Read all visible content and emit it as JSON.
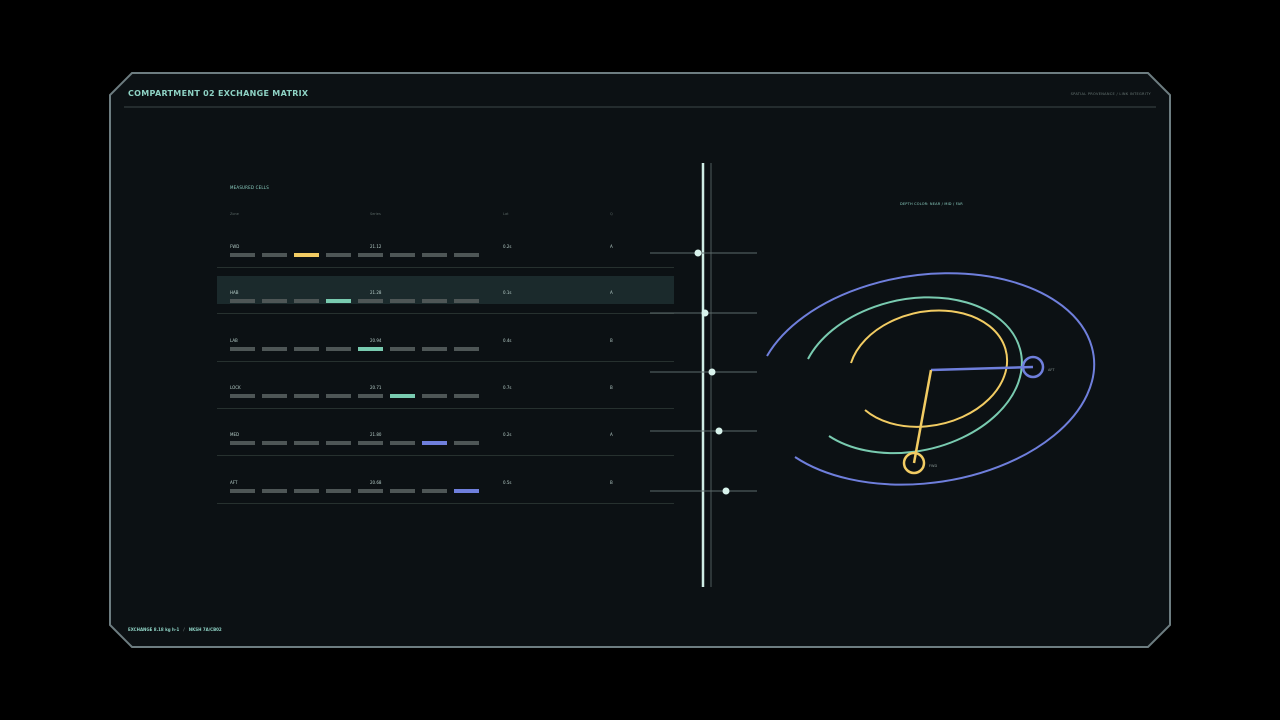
{
  "header": {
    "title": "COMPARTMENT 02 EXCHANGE MATRIX",
    "subtitle": "SPATIAL PROVENANCE / LINK INTEGRITY"
  },
  "table": {
    "section_label": "MEASURED CELLS",
    "columns": [
      "Zone",
      "Series",
      "Lat",
      "Q"
    ],
    "rows": [
      {
        "name": "FWD",
        "value": "21.12",
        "latency": "0.2s",
        "grade": "A",
        "active_cell": 2,
        "active_color": "#f2cc63",
        "selected": false
      },
      {
        "name": "HAB",
        "value": "21.28",
        "latency": "0.1s",
        "grade": "A",
        "active_cell": 3,
        "active_color": "#79cbb0",
        "selected": true
      },
      {
        "name": "LAB",
        "value": "20.94",
        "latency": "0.4s",
        "grade": "B",
        "active_cell": 4,
        "active_color": "#79cbb0",
        "selected": false
      },
      {
        "name": "LOCK",
        "value": "20.71",
        "latency": "0.7s",
        "grade": "B",
        "active_cell": 5,
        "active_color": "#79cbb0",
        "selected": false
      },
      {
        "name": "MED",
        "value": "21.80",
        "latency": "0.2s",
        "grade": "A",
        "active_cell": 6,
        "active_color": "#6f7fdc",
        "selected": false
      },
      {
        "name": "AFT",
        "value": "20.68",
        "latency": "0.5s",
        "grade": "B",
        "active_cell": 7,
        "active_color": "#6f7fdc",
        "selected": false
      }
    ]
  },
  "map": {
    "depth_legend": "DEPTH COLOR: NEAR / MID / FAR",
    "node_near_label": "FWD",
    "node_far_label": "AFT",
    "colors": {
      "near": "#f2cc63",
      "mid": "#79cbb0",
      "far": "#6f7fdc"
    }
  },
  "footer": {
    "exchange": "EXCHANGE 8.18 kg h-1",
    "node": "NKSH 7A/CB02"
  }
}
